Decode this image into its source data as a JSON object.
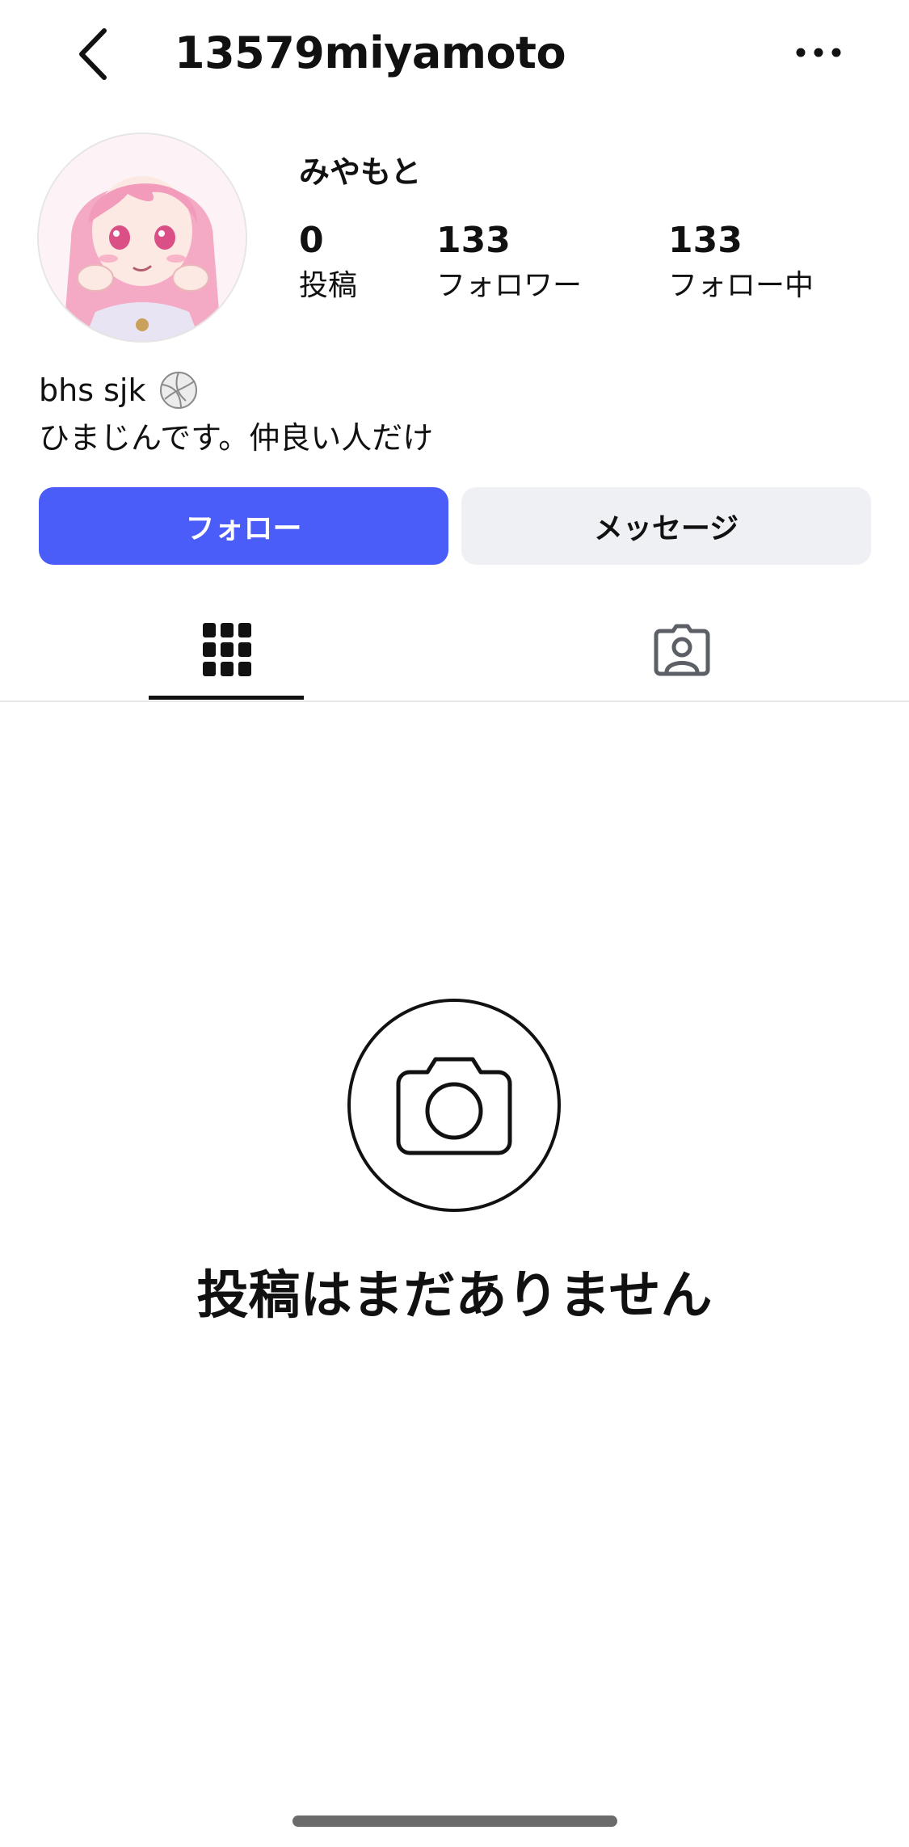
{
  "header": {
    "back_icon": "chevron-left-icon",
    "title": "13579miyamoto",
    "more_icon": "ellipsis-icon"
  },
  "profile": {
    "display_name": "みやもと",
    "stats": {
      "posts": {
        "value": "0",
        "label": "投稿"
      },
      "followers": {
        "value": "133",
        "label": "フォロワー"
      },
      "following": {
        "value": "133",
        "label": "フォロー中"
      }
    },
    "bio_line1": "bhs sjk",
    "bio_line2": "ひまじんです。仲良い人だけ"
  },
  "actions": {
    "follow_label": "フォロー",
    "message_label": "メッセージ"
  },
  "tabs": {
    "grid_icon": "grid-icon",
    "tagged_icon": "tagged-person-icon",
    "active": "grid"
  },
  "empty_state": {
    "icon": "camera-icon",
    "text": "投稿はまだありません"
  },
  "colors": {
    "follow_button": "#4a5df9",
    "message_button": "#eff0f4",
    "avatar_hair": "#f4a9c4"
  }
}
